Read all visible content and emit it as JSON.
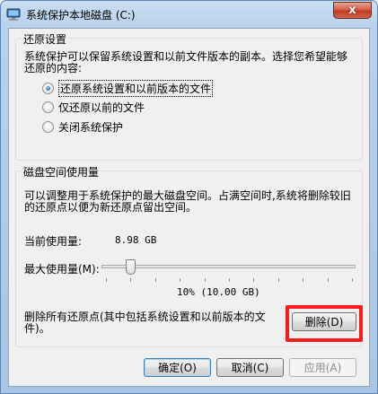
{
  "window": {
    "title": "系统保护本地磁盘 (C:)",
    "close_glyph": "x",
    "frame_color": "#b9d1ea"
  },
  "restore_settings": {
    "group_title": "还原设置",
    "description": "系统保护可以保留系统设置和以前文件版本的副本。选择您希望能够还原的内容:",
    "options": [
      {
        "label": "还原系统设置和以前版本的文件",
        "checked": true
      },
      {
        "label": "仅还原以前的文件",
        "checked": false
      },
      {
        "label": "关闭系统保护",
        "checked": false
      }
    ]
  },
  "disk_usage": {
    "group_title": "磁盘空间使用量",
    "description": "可以调整用于系统保护的最大磁盘空间。占满空间时,系统将删除较旧的还原点以便为新还原点留出空间。",
    "current_label": "当前使用量:",
    "current_value": "8.98 GB",
    "max_label": "最大使用量(M):",
    "slider_percent": 10,
    "max_value": "10% (10.00 GB)",
    "delete_description": "删除所有还原点(其中包括系统设置和以前版本的文件)。",
    "delete_button": "删除(D)",
    "highlight_color": "#ff1a1a"
  },
  "footer": {
    "ok_button": "确定(O)",
    "cancel_button": "取消(C)",
    "apply_button": "应用(A)"
  }
}
